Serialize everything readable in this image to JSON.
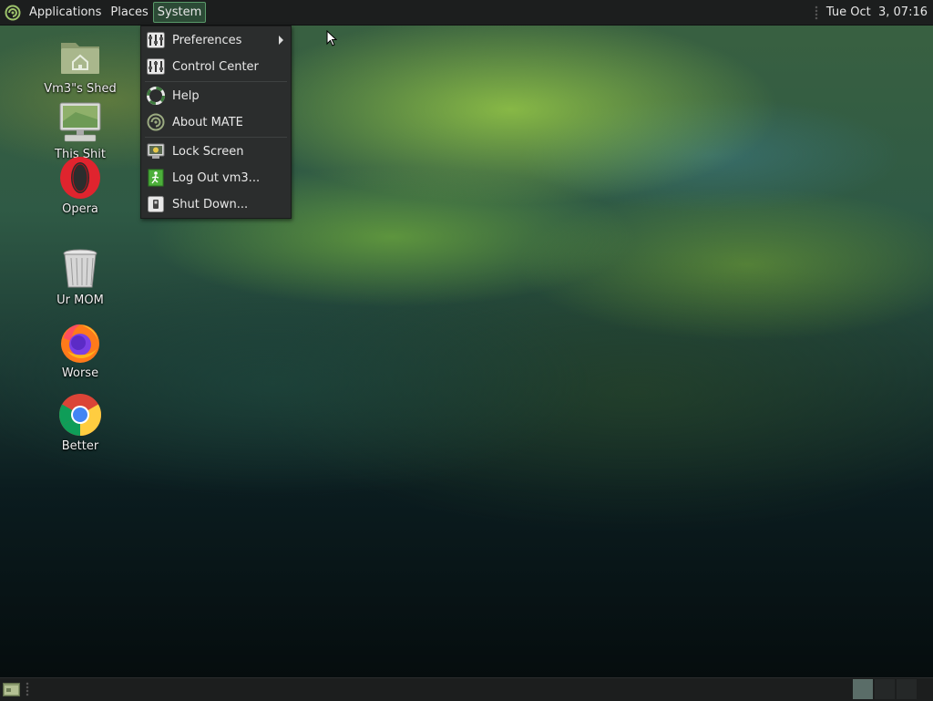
{
  "top_panel": {
    "menus": [
      {
        "label": "Applications"
      },
      {
        "label": "Places"
      },
      {
        "label": "System",
        "active": true
      }
    ],
    "clock": "Tue Oct  3, 07:16"
  },
  "system_menu": {
    "items": [
      {
        "label": "Preferences",
        "icon": "preferences-icon",
        "has_submenu": true
      },
      {
        "label": "Control Center",
        "icon": "control-center-icon"
      },
      {
        "label": "Help",
        "icon": "help-lifebuoy-icon"
      },
      {
        "label": "About MATE",
        "icon": "mate-logo-icon"
      },
      {
        "label": "Lock Screen",
        "icon": "lock-screen-icon"
      },
      {
        "label": "Log Out vm3...",
        "icon": "log-out-icon"
      },
      {
        "label": "Shut Down...",
        "icon": "shut-down-icon"
      }
    ]
  },
  "desktop_icons": [
    {
      "label": "Vm3\"s Shed",
      "icon": "home-folder-icon"
    },
    {
      "label": "This Shit",
      "icon": "computer-icon"
    },
    {
      "label": "Opera",
      "icon": "opera-icon"
    },
    {
      "label": "Ur MOM",
      "icon": "trash-icon"
    },
    {
      "label": "Worse",
      "icon": "firefox-icon"
    },
    {
      "label": "Better",
      "icon": "chrome-icon"
    }
  ],
  "bottom_panel": {
    "workspaces": [
      "workspace-1",
      "workspace-2",
      "workspace-3"
    ],
    "active_workspace": 1
  },
  "colors": {
    "panel_bg": "#1c1e1e",
    "menu_bg": "#2b2d2d",
    "active_menu_bg": "#2c4a36",
    "accent_green": "#8bc34a"
  }
}
